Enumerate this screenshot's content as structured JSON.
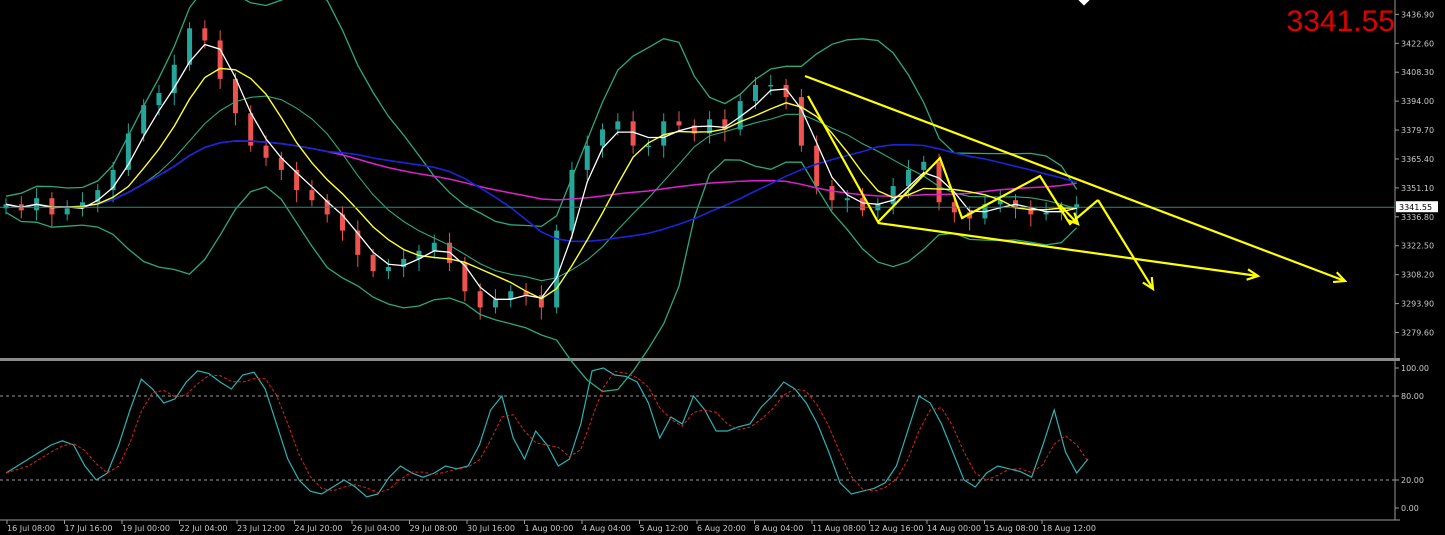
{
  "chart_data": [
    {
      "type": "candlestick",
      "symbol_price_readout": "3341.55",
      "current_price_label": "3341.55",
      "y_ticks": [
        "3436.90",
        "3422.60",
        "3408.30",
        "3394.00",
        "3379.70",
        "3365.40",
        "3351.10",
        "3336.80",
        "3322.50",
        "3308.20",
        "3293.90",
        "3279.60"
      ],
      "ylim": [
        3267.0,
        3444.0
      ],
      "x_tick_labels": [
        "16 Jul 08:00",
        "17 Jul 16:00",
        "19 Jul 00:00",
        "22 Jul 04:00",
        "23 Jul 12:00",
        "24 Jul 20:00",
        "26 Jul 04:00",
        "29 Jul 08:00",
        "30 Jul 16:00",
        "1 Aug 00:00",
        "4 Aug 04:00",
        "5 Aug 12:00",
        "6 Aug 20:00",
        "8 Aug 04:00",
        "11 Aug 08:00",
        "12 Aug 16:00",
        "14 Aug 00:00",
        "15 Aug 08:00",
        "18 Aug 12:00"
      ],
      "close_path": [
        3343,
        3340,
        3346,
        3338,
        3341,
        3344,
        3350,
        3360,
        3378,
        3392,
        3398,
        3412,
        3430,
        3424,
        3405,
        3388,
        3372,
        3366,
        3360,
        3350,
        3345,
        3338,
        3330,
        3318,
        3310,
        3312,
        3316,
        3320,
        3324,
        3314,
        3300,
        3292,
        3296,
        3300,
        3298,
        3292,
        3330,
        3360,
        3372,
        3380,
        3384,
        3372,
        3372,
        3384,
        3382,
        3378,
        3385,
        3380,
        3394,
        3402,
        3402,
        3396,
        3372,
        3352,
        3345,
        3346,
        3340,
        3343,
        3352,
        3360,
        3364,
        3344,
        3339,
        3336,
        3343,
        3345,
        3341,
        3338,
        3339,
        3341,
        3343
      ],
      "colors": {
        "bull": "#26a69a",
        "bear": "#ef5350",
        "bollinger": "#2ea87b",
        "ma_fast": "#ffffff",
        "ma_slow": "#ffff30",
        "ma_blue": "#1a25d8",
        "ma_magenta": "#e020d0",
        "annotation": "#ffff00",
        "price_line": "#2a8a7a",
        "readout": "#e00000"
      },
      "grid": false
    },
    {
      "type": "line",
      "indicator": "stochastic",
      "y_ticks": [
        "100.00",
        "80.00",
        "20.00",
        "0.00"
      ],
      "ylim": [
        0,
        100
      ],
      "levels": [
        80,
        20
      ],
      "main": [
        25,
        30,
        35,
        40,
        45,
        48,
        45,
        30,
        20,
        25,
        45,
        70,
        92,
        85,
        75,
        78,
        90,
        98,
        96,
        90,
        85,
        95,
        97,
        85,
        60,
        35,
        20,
        12,
        10,
        15,
        20,
        15,
        8,
        10,
        22,
        30,
        25,
        22,
        25,
        30,
        28,
        30,
        45,
        70,
        80,
        50,
        35,
        55,
        45,
        30,
        35,
        60,
        98,
        100,
        95,
        94,
        90,
        75,
        50,
        65,
        60,
        80,
        70,
        55,
        55,
        58,
        60,
        72,
        80,
        90,
        85,
        75,
        60,
        40,
        18,
        10,
        12,
        14,
        18,
        30,
        55,
        80,
        75,
        60,
        40,
        20,
        15,
        25,
        30,
        28,
        26,
        22,
        45,
        70,
        40,
        25,
        35
      ]
    }
  ]
}
